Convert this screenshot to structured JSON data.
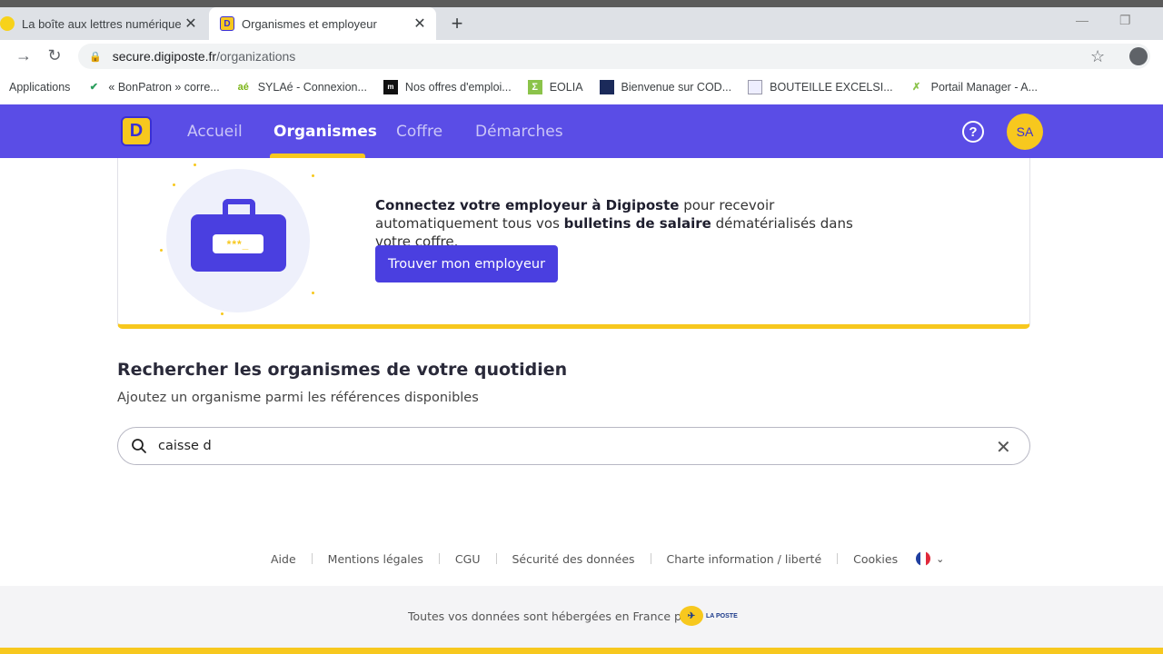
{
  "browser": {
    "tabs": [
      {
        "title": "La boîte aux lettres numérique, in",
        "active": false
      },
      {
        "title": "Organismes et employeur",
        "active": true
      }
    ],
    "url_host": "secure.digiposte.fr",
    "url_path": "/organizations",
    "bookmarks": [
      {
        "label": "Applications",
        "icon": "apps-grid-icon"
      },
      {
        "label": "« BonPatron » corre...",
        "icon": "check-badge-icon"
      },
      {
        "label": "SYLAé - Connexion...",
        "icon": "sylae-logo-icon"
      },
      {
        "label": "Nos offres d'emploi...",
        "icon": "ml-logo-icon"
      },
      {
        "label": "EOLIA",
        "icon": "eolia-logo-icon"
      },
      {
        "label": "Bienvenue sur COD...",
        "icon": "cod-logo-icon"
      },
      {
        "label": "BOUTEILLE EXCELSI...",
        "icon": "document-icon"
      },
      {
        "label": "Portail Manager - A...",
        "icon": "runner-icon"
      }
    ]
  },
  "app": {
    "nav": [
      {
        "label": "Accueil",
        "active": false
      },
      {
        "label": "Organismes",
        "active": true
      },
      {
        "label": "Coffre",
        "active": false
      },
      {
        "label": "Démarches",
        "active": false
      }
    ],
    "help_symbol": "?",
    "avatar_initials": "SA",
    "accent_color": "#5a4de6",
    "brand_yellow": "#f7c81e"
  },
  "employer_card": {
    "text_bold_1": "Connectez votre employeur à Digiposte",
    "text_1": " pour recevoir automatiquement tous vos ",
    "text_bold_2": "bulletins de salaire",
    "text_2": " dématérialisés dans votre coffre.",
    "button_label": "Trouver mon employeur",
    "illustration_label": "***_"
  },
  "search": {
    "title": "Rechercher les organismes de votre quotidien",
    "subtitle": "Ajoutez un organisme parmi les références disponibles",
    "value": "caisse d",
    "clear_symbol": "✕"
  },
  "footer": {
    "links": [
      "Aide",
      "Mentions légales",
      "CGU",
      "Sécurité des données",
      "Charte information / liberté",
      "Cookies"
    ],
    "hosting_note": "Toutes vos données sont hébergées en France par",
    "laposte_label": "LA POSTE"
  }
}
